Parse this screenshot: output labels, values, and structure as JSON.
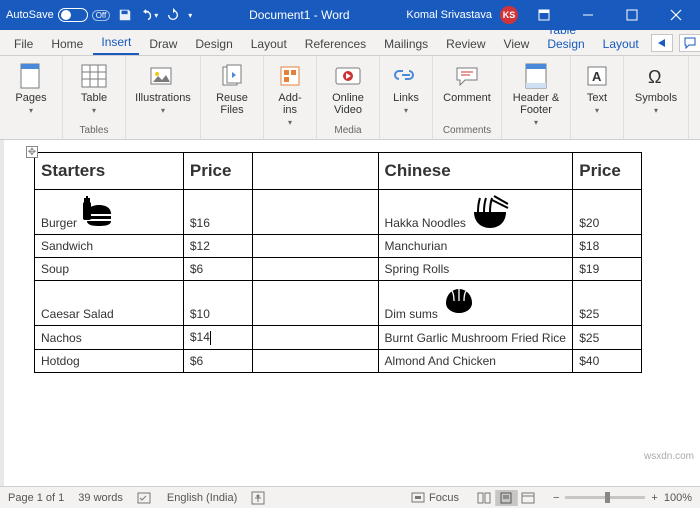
{
  "titlebar": {
    "autosave": "AutoSave",
    "autosave_state": "Off",
    "doc_title": "Document1 - Word",
    "user_name": "Komal Srivastava",
    "user_initials": "KS"
  },
  "tabs": {
    "file": "File",
    "home": "Home",
    "insert": "Insert",
    "draw": "Draw",
    "design": "Design",
    "layout": "Layout",
    "references": "References",
    "mailings": "Mailings",
    "review": "Review",
    "view": "View",
    "table_design": "Table Design",
    "layout2": "Layout"
  },
  "ribbon": {
    "pages": "Pages",
    "table": "Table",
    "tables_grp": "Tables",
    "illustrations": "Illustrations",
    "reuse_files": "Reuse\nFiles",
    "addins": "Add-\nins",
    "online_video": "Online\nVideo",
    "media_grp": "Media",
    "links": "Links",
    "comment": "Comment",
    "comments_grp": "Comments",
    "header_footer": "Header &\nFooter",
    "text": "Text",
    "symbols": "Symbols"
  },
  "doc": {
    "h_starters": "Starters",
    "h_price": "Price",
    "h_chinese": "Chinese",
    "left_rows": [
      {
        "name": "Burger",
        "price": "$16",
        "has_icon": true
      },
      {
        "name": "Sandwich",
        "price": "$12"
      },
      {
        "name": "Soup",
        "price": "$6"
      },
      {
        "name": "Caesar Salad",
        "price": "$10"
      },
      {
        "name": "Nachos",
        "price": "$14",
        "cursor": true
      },
      {
        "name": "Hotdog",
        "price": "$6"
      }
    ],
    "right_rows": [
      {
        "name": "Hakka Noodles",
        "price": "$20",
        "has_icon": true
      },
      {
        "name": "Manchurian",
        "price": "$18"
      },
      {
        "name": "Spring Rolls",
        "price": "$19"
      },
      {
        "name": "Dim sums",
        "price": "$25",
        "has_icon": true
      },
      {
        "name": "Burnt Garlic Mushroom Fried Rice",
        "price": "$25"
      },
      {
        "name": "Almond And Chicken",
        "price": "$40"
      }
    ]
  },
  "statusbar": {
    "page": "Page 1 of 1",
    "words": "39 words",
    "language": "English (India)",
    "focus": "Focus",
    "zoom": "100%"
  },
  "watermark": "wsxdn.com"
}
